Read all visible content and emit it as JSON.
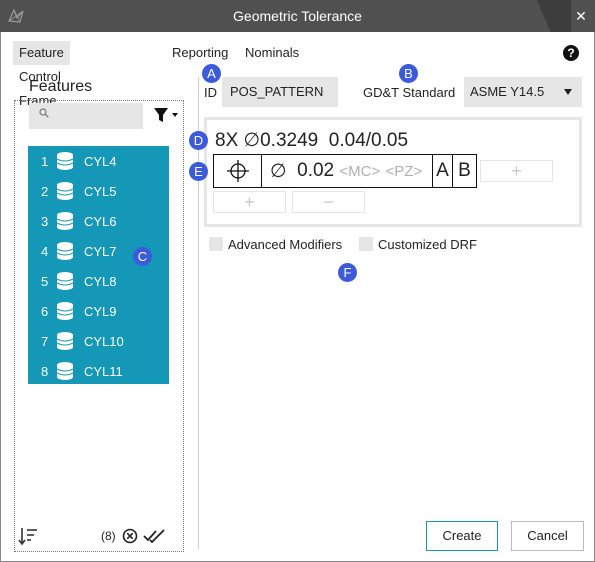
{
  "window": {
    "title": "Geometric Tolerance",
    "close_glyph": "✕",
    "logo_icon": "app-logo-icon"
  },
  "tabs": [
    {
      "label": "Feature Control Frame",
      "active": true
    },
    {
      "label": "Reporting",
      "active": false
    },
    {
      "label": "Nominals",
      "active": false
    }
  ],
  "help_glyph": "?",
  "callouts": {
    "a": "A",
    "b": "B",
    "c": "C",
    "d": "D",
    "e": "E",
    "f": "F"
  },
  "features": {
    "title": "Features",
    "search_placeholder": "",
    "items": [
      {
        "num": "1",
        "label": "CYL4"
      },
      {
        "num": "2",
        "label": "CYL5"
      },
      {
        "num": "3",
        "label": "CYL6"
      },
      {
        "num": "4",
        "label": "CYL7"
      },
      {
        "num": "5",
        "label": "CYL8"
      },
      {
        "num": "6",
        "label": "CYL9"
      },
      {
        "num": "7",
        "label": "CYL10"
      },
      {
        "num": "8",
        "label": "CYL11"
      }
    ],
    "selected_count": "(8)",
    "highlight_color": "#1598b8"
  },
  "id_field": {
    "label": "ID",
    "value": "POS_PATTERN"
  },
  "gdt_standard": {
    "label": "GD&T Standard",
    "value": "ASME Y14.5"
  },
  "pattern_line": {
    "count": "8X",
    "diameter_symbol": "∅",
    "size": "0.3249",
    "tolerance": "0.04/0.05"
  },
  "fcf": {
    "characteristic_icon": "position-icon",
    "diameter_symbol": "∅",
    "tolerance": "0.02",
    "mc_placeholder": "<MC>",
    "pz_placeholder": "<PZ>",
    "datums": [
      "A",
      "B"
    ]
  },
  "add_glyph": "+",
  "remove_glyph": "−",
  "options": {
    "advanced_modifiers": "Advanced Modifiers",
    "customized_drf": "Customized DRF"
  },
  "buttons": {
    "create": "Create",
    "cancel": "Cancel"
  },
  "colors": {
    "accent": "#1598b8",
    "callout": "#3b5bdb",
    "titlebar": "#505050"
  }
}
